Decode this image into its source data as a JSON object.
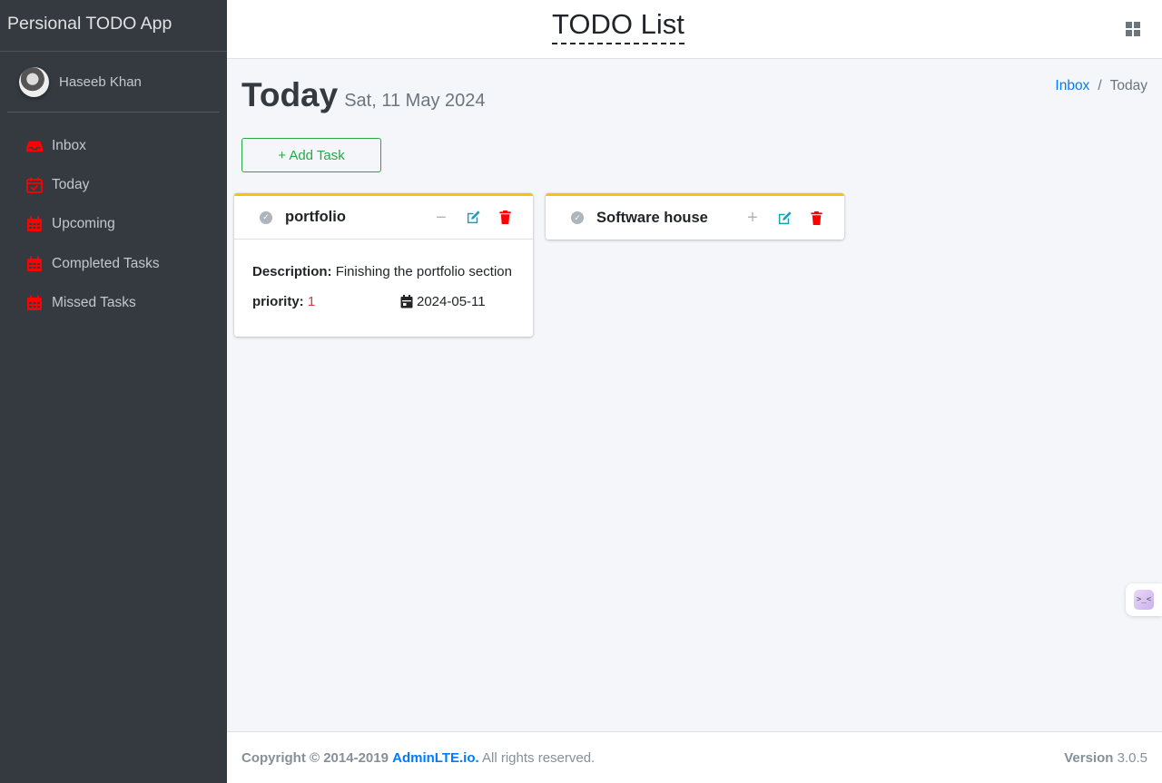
{
  "app": {
    "brand": "Persional TODO App",
    "user_name": "Haseeb Khan"
  },
  "sidebar": {
    "items": [
      {
        "label": "Inbox",
        "icon": "inbox-icon"
      },
      {
        "label": "Today",
        "icon": "calendar-check-icon"
      },
      {
        "label": "Upcoming",
        "icon": "calendar-icon"
      },
      {
        "label": "Completed Tasks",
        "icon": "calendar-icon"
      },
      {
        "label": "Missed Tasks",
        "icon": "calendar-icon"
      }
    ],
    "icon_color": "#ff0000"
  },
  "header": {
    "title": "TODO List",
    "grid_icon": "grid-icon"
  },
  "page": {
    "title": "Today",
    "date": "Sat, 11 May 2024",
    "breadcrumb": {
      "link": "Inbox",
      "separator": "/",
      "current": "Today"
    },
    "add_task_label": "+ Add Task"
  },
  "tasks": [
    {
      "title": "portfolio",
      "collapse_symbol": "−",
      "description_label": "Description:",
      "description": "Finishing the portfolio section",
      "priority_label": "priority:",
      "priority": "1",
      "date": "2024-05-11"
    },
    {
      "title": "Software house",
      "expand_symbol": "+"
    }
  ],
  "footer": {
    "copyright_prefix": "Copyright © 2014-2019",
    "link": "AdminLTE.io.",
    "rights": "All rights reserved.",
    "version_label": "Version",
    "version": "3.0.5"
  },
  "colors": {
    "sidebar_bg": "#343a40",
    "accent_border": "#ffc107",
    "success": "#28a745",
    "link": "#007bff",
    "danger": "#ff0000",
    "edit": "#17a2b8"
  }
}
